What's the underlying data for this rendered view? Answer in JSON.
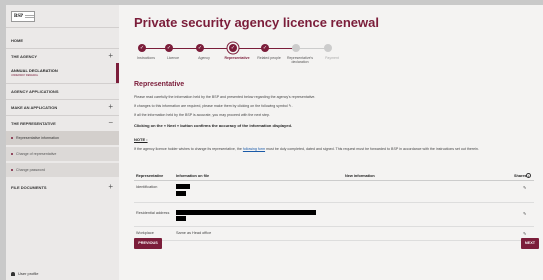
{
  "sidebar": {
    "logo_text": "BSP",
    "items": {
      "home": "HOME",
      "agency": "THE AGENCY",
      "annual": "ANNUAL DECLARATION",
      "annual_sub": "UNDERWAY RENEWAL",
      "applications": "AGENCY APPLICATIONS",
      "make": "MAKE AN APPLICATION",
      "rep": "THE REPRESENTATIVE",
      "rep_info": "Representative information",
      "change_rep": "Change of representative",
      "change_pw": "Change password",
      "files": "FILE DOCUMENTS"
    },
    "user": "User profile"
  },
  "main": {
    "title": "Private security agency licence renewal",
    "steps": [
      {
        "label": "Instructions"
      },
      {
        "label": "Licence"
      },
      {
        "label": "Agency"
      },
      {
        "label": "Representative"
      },
      {
        "label": "Related people"
      },
      {
        "label": "Representative's declaration"
      },
      {
        "label": "Payment"
      }
    ],
    "section_title": "Representative",
    "p1": "Please read carefully the information held by the BSP and presented below regarding the agency's representative.",
    "p2": "If changes to this information are required, please make them by clicking on the following symbol",
    "p3": "If all the information held by the BSP is accurate, you may proceed with the next step.",
    "p4": "Clicking on the « Next » button confirms the accuracy of the information displayed.",
    "note": "NOTE :",
    "p5a": "If the agency licence holder wishes to change its representative, the",
    "p5link": "following form",
    "p5b": "must be duly completed, dated and signed. This request must be forwarded to BSP in accordance with the instructions set out therein.",
    "table": {
      "headers": [
        "Representative",
        "Information on file",
        "New information",
        "Shares"
      ],
      "rows": [
        {
          "label": "Identification"
        },
        {
          "label": "Residential address"
        },
        {
          "label": "Workplace",
          "value": "Same as Head office"
        }
      ]
    },
    "buttons": {
      "previous": "PREVIOUS",
      "next": "NEXT"
    }
  },
  "colors": {
    "accent": "#7b1d3a"
  }
}
